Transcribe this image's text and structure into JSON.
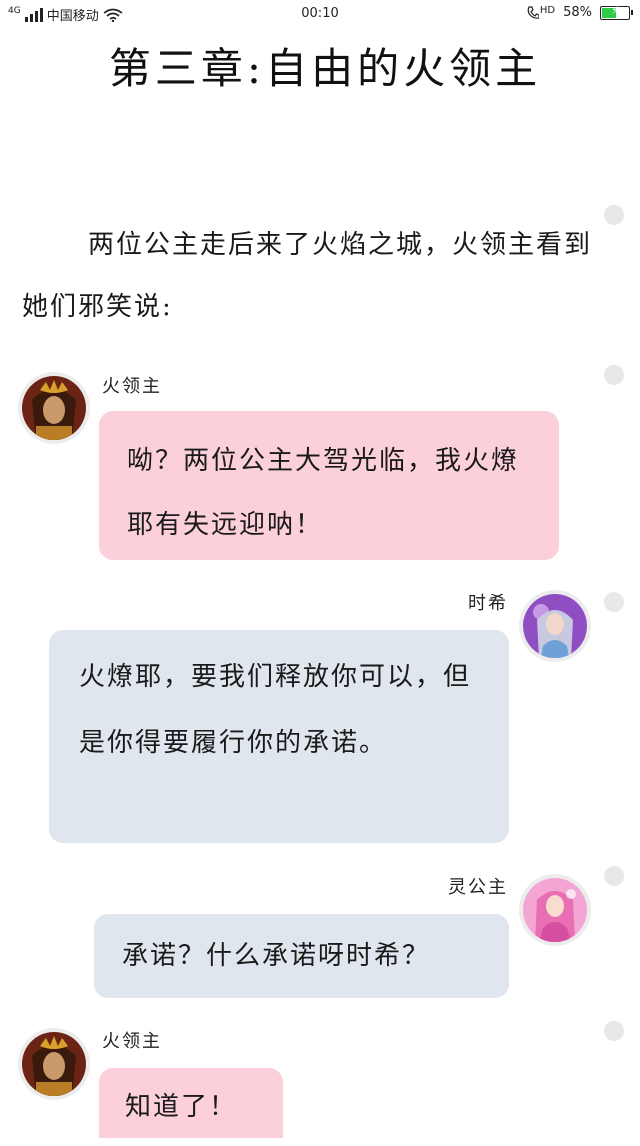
{
  "status_bar": {
    "network_type": "4G",
    "carrier": "中国移动",
    "time": "00:10",
    "hd_label": "HD",
    "battery_percent_label": "58%",
    "battery_level": 0.58,
    "battery_color": "#2fcc4a",
    "icons": [
      "signal-bars-icon",
      "wifi-icon",
      "phone-hd-icon",
      "battery-icon"
    ]
  },
  "story": {
    "title": "第三章:自由的火领主",
    "narration": "两位公主走后来了火焰之城，火领主看到她们邪笑说:"
  },
  "messages": [
    {
      "speaker": "火领主",
      "side": "left",
      "bubble_color": "#fbd0db",
      "text": "呦？两位公主大驾光临，我火燎耶有失远迎呐！"
    },
    {
      "speaker": "时希",
      "side": "right",
      "bubble_color": "#dfe6ee",
      "text": "火燎耶，要我们释放你可以，但是你得要履行你的承诺。"
    },
    {
      "speaker": "灵公主",
      "side": "right",
      "bubble_color": "#dfe6ee",
      "text": "承诺？什么承诺呀时希？"
    },
    {
      "speaker": "火领主",
      "side": "left",
      "bubble_color": "#fbd0db",
      "text": "知道了！"
    }
  ],
  "colors": {
    "pink_bubble": "#fbd0db",
    "blue_bubble": "#dfe6ee",
    "side_dot": "#e8e8e8"
  }
}
